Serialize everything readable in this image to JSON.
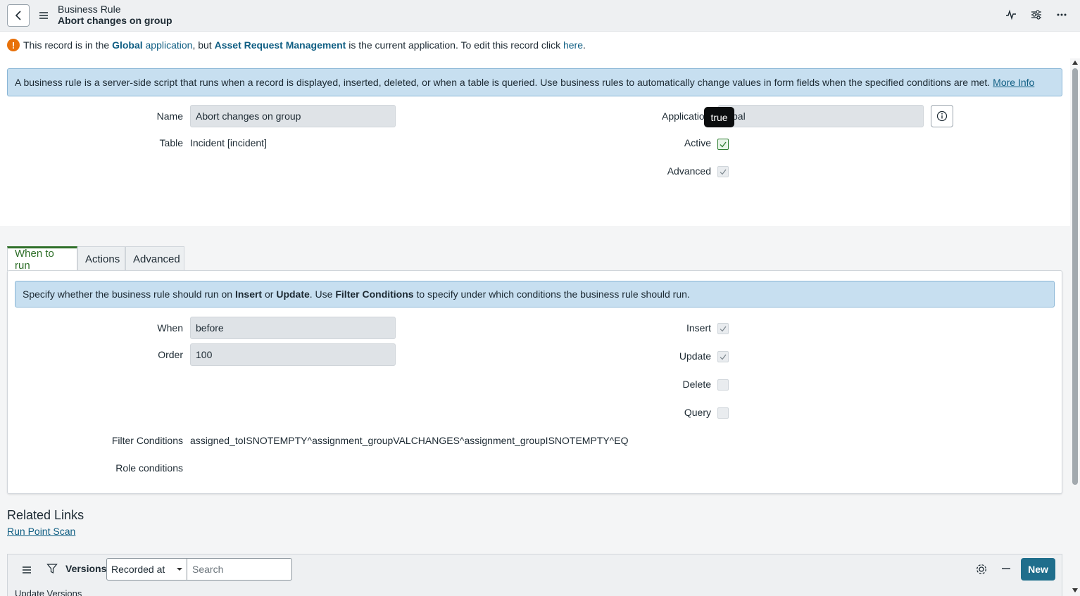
{
  "header": {
    "title": "Business Rule",
    "subtitle": "Abort changes on group"
  },
  "notice": {
    "icon_text": "!",
    "t1": "This record is in the",
    "global": "Global",
    "application": "application",
    "t2": ", but",
    "app_name": "Asset Request Management",
    "t3": "is the current application. To edit this record click",
    "here": "here",
    "t4": "."
  },
  "info": {
    "text": "A business rule is a server-side script that runs when a record is displayed, inserted, deleted, or when a table is queried. Use business rules to automatically change values in form fields when the specified conditions are met.",
    "more_info": "More Info"
  },
  "form": {
    "name_label": "Name",
    "name_value": "Abort changes on group",
    "table_label": "Table",
    "table_value": "Incident [incident]",
    "application_label": "Applicatio",
    "application_value": "bal",
    "tooltip": "true",
    "active_label": "Active",
    "advanced_label": "Advanced"
  },
  "tabs": [
    {
      "label": "When to run"
    },
    {
      "label": "Actions"
    },
    {
      "label": "Advanced"
    }
  ],
  "when_to_run": {
    "info_t1": "Specify whether the business rule should run on",
    "insert_b": "Insert",
    "or": "or",
    "update_b": "Update",
    "info_t2": ". Use",
    "filter_b": "Filter Conditions",
    "info_t3": "to specify under which conditions the business rule should run.",
    "when_label": "When",
    "when_value": "before",
    "order_label": "Order",
    "order_value": "100",
    "insert_label": "Insert",
    "update_label": "Update",
    "delete_label": "Delete",
    "query_label": "Query",
    "filter_label": "Filter Conditions",
    "filter_value": "assigned_toISNOTEMPTY^assignment_groupVALCHANGES^assignment_groupISNOTEMPTY^EQ",
    "role_label": "Role conditions"
  },
  "related": {
    "title": "Related Links",
    "link": "Run Point Scan"
  },
  "versions": {
    "label": "Versions",
    "select_value": "Recorded at",
    "search_placeholder": "Search",
    "new_label": "New",
    "sub_title": "Update Versions"
  },
  "colors": {
    "link": "#0f5e83",
    "info_bg": "#c7dff0",
    "tab_accent": "#2e6f28",
    "new_button": "#1f6e8c",
    "warning": "#e8710a"
  }
}
